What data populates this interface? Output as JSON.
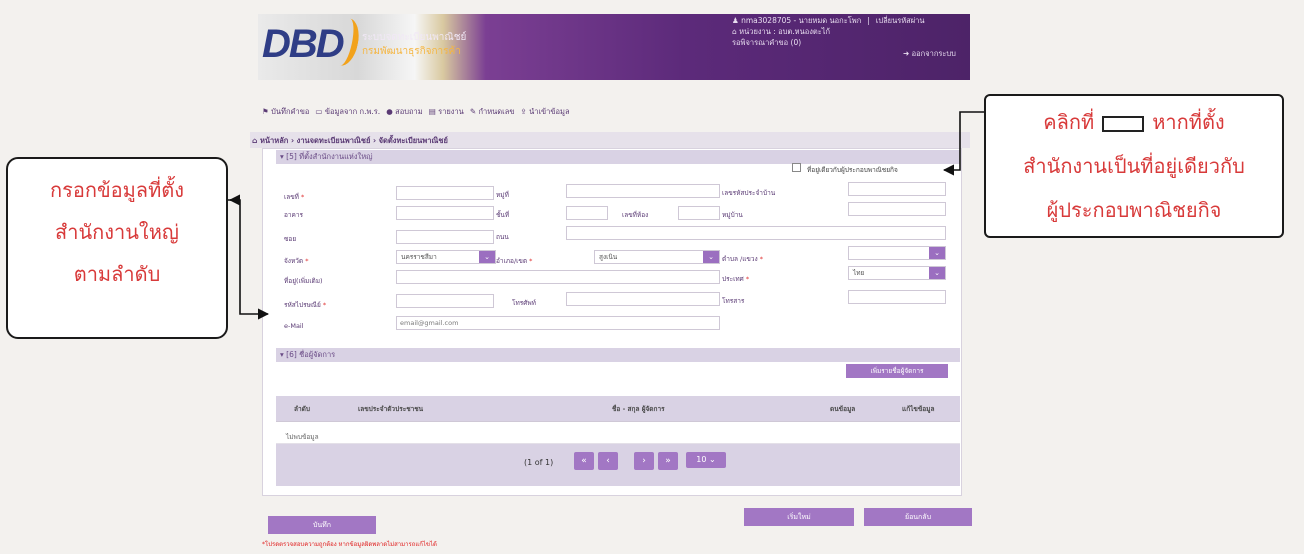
{
  "banner": {
    "logo_text": "DBD",
    "system_title": "ระบบจดทะเบียนพาณิชย์",
    "department": "กรมพัฒนาธุรกิจการค้า",
    "user": "nma3028705 - นายหมด นอกะโพก",
    "change_password": "เปลี่ยนรหัสผ่าน",
    "unit": "หน่วยงาน : อบต.หนองตะไก้",
    "pending": "รอพิจารณาคำขอ (0)",
    "logout": "ออกจากระบบ"
  },
  "menu": {
    "items": [
      "บันทึกคำขอ",
      "ข้อมูลจาก ก.พ.ร.",
      "สอบถาม",
      "รายงาน",
      "กำหนดเลข",
      "นำเข้าข้อมูล"
    ]
  },
  "breadcrumb": "หน้าหลัก › งานจดทะเบียนพาณิชย์ › จัดตั้งทะเบียนพาณิชย์",
  "section5": {
    "title": "[5] ที่ตั้งสำนักงานแห่งใหญ่",
    "same_address_label": "ที่อยู่เดียวกับผู้ประกอบพาณิชยกิจ",
    "labels": {
      "house_no": "เลขที่",
      "moo": "หมู่ที่",
      "house_reg_no": "เลขรหัสประจำบ้าน",
      "building": "อาคาร",
      "floor": "ชั้นที่",
      "room": "เลขที่ห้อง",
      "village": "หมู่บ้าน",
      "soi": "ซอย",
      "road": "ถนน",
      "province": "จังหวัด",
      "district": "อำเภอ/เขต",
      "subdistrict": "ตำบล /แขวง",
      "address_extra": "ที่อยู่(เพิ่มเติม)",
      "country": "ประเทศ",
      "postcode": "รหัสไปรษณีย์",
      "phone": "โทรศัพท์",
      "fax": "โทรสาร",
      "email": "e-Mail"
    },
    "values": {
      "province": "นครราชสีมา",
      "district": "สูงเนิน",
      "subdistrict": "",
      "country": "ไทย"
    },
    "email_placeholder": "email@gmail.com"
  },
  "section6": {
    "title": "[6] ชื่อผู้จัดการ",
    "add_button": "เพิ่มรายชื่อผู้จัดการ",
    "columns": [
      "ลำดับ",
      "เลขประจำตัวประชาชน",
      "ชื่อ - สกุล ผู้จัดการ",
      "ดนข้อมูล",
      "แก้ไขข้อมูล"
    ],
    "empty_text": "ไม่พบข้อมูล",
    "pager_text": "(1 of 1)",
    "page_size": "10"
  },
  "actions": {
    "save": "บันทึก",
    "new": "เริ่มใหม่",
    "back": "ย้อนกลับ"
  },
  "note": "*โปรดตรวจสอบความถูกต้อง หากข้อมูลผิดพลาดไม่สามารถแก้ไขได้",
  "callouts": {
    "left_lines": [
      "กรอกข้อมูลที่ตั้ง",
      "สำนักงานใหญ่",
      "ตามลำดับ"
    ],
    "right_line1a": "คลิกที่",
    "right_line1b": "หากที่ตั้ง",
    "right_line2": "สำนักงานเป็นที่อยู่เดียวกับ",
    "right_line3": "ผู้ประกอบพาณิชยกิจ"
  },
  "colors": {
    "primary_purple": "#a277c4",
    "header_purple": "#5c2a7a",
    "section_bg": "#d9d2e4",
    "callout_text": "#d83a3a"
  }
}
